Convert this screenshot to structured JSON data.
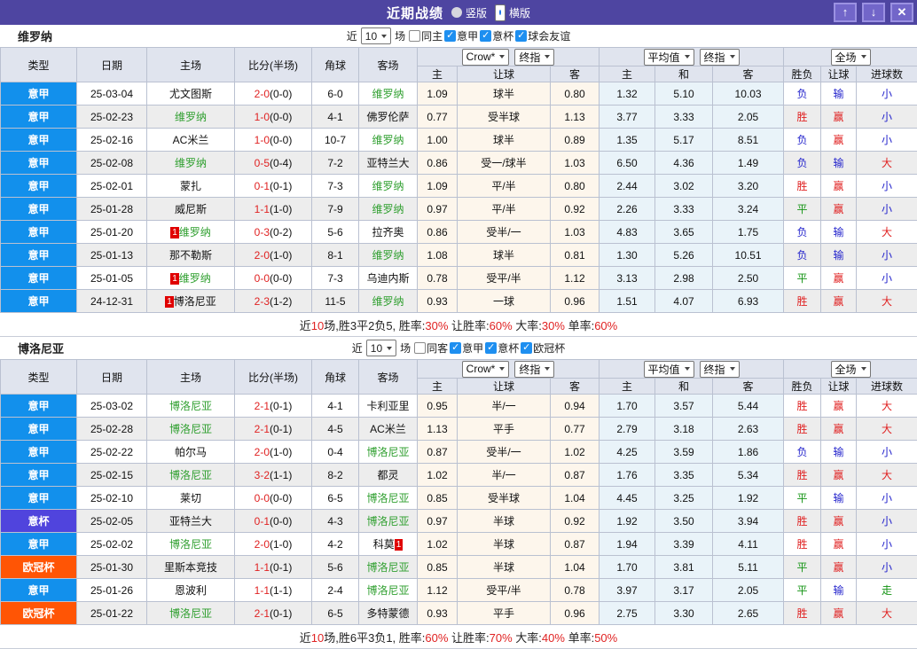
{
  "titlebar": {
    "title": "近期战绩",
    "radios": [
      {
        "label": "竖版",
        "selected": false
      },
      {
        "label": "横版",
        "selected": true
      }
    ],
    "buttons": {
      "up": "↑",
      "down": "↓",
      "close": "✕"
    }
  },
  "columns": [
    "类型",
    "日期",
    "主场",
    "比分(半场)",
    "角球",
    "客场",
    "主",
    "让球",
    "客",
    "主",
    "和",
    "客",
    "胜负",
    "让球",
    "进球数"
  ],
  "header_dropdowns": {
    "odds_source": "Crow*",
    "odds_final": "终指",
    "avg": "平均值",
    "avg_final": "终指",
    "scope": "全场"
  },
  "league_colors": {
    "意甲": "lg-serie",
    "意杯": "lg-coppa",
    "欧冠杯": "lg-ucl"
  },
  "sections": [
    {
      "team": "维罗纳",
      "filter": {
        "prefix": "近",
        "count": "10",
        "suffix": "场",
        "checks": [
          {
            "label": "同主",
            "checked": false
          },
          {
            "label": "意甲",
            "checked": true
          },
          {
            "label": "意杯",
            "checked": true
          },
          {
            "label": "球会友谊",
            "checked": true
          }
        ]
      },
      "rows": [
        {
          "league": "意甲",
          "date": "25-03-04",
          "home": {
            "name": "尤文图斯",
            "green": false,
            "badge": null
          },
          "score": "2-0",
          "half": "(0-0)",
          "corner": "6-0",
          "away": {
            "name": "维罗纳",
            "green": true,
            "badge": null
          },
          "odds": [
            "1.09",
            "球半",
            "0.80"
          ],
          "avg": [
            "1.32",
            "5.10",
            "10.03"
          ],
          "results": [
            {
              "t": "负",
              "c": "blue"
            },
            {
              "t": "输",
              "c": "blue"
            },
            {
              "t": "小",
              "c": "blue"
            }
          ]
        },
        {
          "league": "意甲",
          "date": "25-02-23",
          "home": {
            "name": "维罗纳",
            "green": true,
            "badge": null
          },
          "score": "1-0",
          "half": "(0-0)",
          "corner": "4-1",
          "away": {
            "name": "佛罗伦萨",
            "green": false,
            "badge": null
          },
          "odds": [
            "0.77",
            "受半球",
            "1.13"
          ],
          "avg": [
            "3.77",
            "3.33",
            "2.05"
          ],
          "results": [
            {
              "t": "胜",
              "c": "red"
            },
            {
              "t": "赢",
              "c": "red"
            },
            {
              "t": "小",
              "c": "blue"
            }
          ]
        },
        {
          "league": "意甲",
          "date": "25-02-16",
          "home": {
            "name": "AC米兰",
            "green": false,
            "badge": null
          },
          "score": "1-0",
          "half": "(0-0)",
          "corner": "10-7",
          "away": {
            "name": "维罗纳",
            "green": true,
            "badge": null
          },
          "odds": [
            "1.00",
            "球半",
            "0.89"
          ],
          "avg": [
            "1.35",
            "5.17",
            "8.51"
          ],
          "results": [
            {
              "t": "负",
              "c": "blue"
            },
            {
              "t": "赢",
              "c": "red"
            },
            {
              "t": "小",
              "c": "blue"
            }
          ]
        },
        {
          "league": "意甲",
          "date": "25-02-08",
          "home": {
            "name": "维罗纳",
            "green": true,
            "badge": null
          },
          "score": "0-5",
          "half": "(0-4)",
          "corner": "7-2",
          "away": {
            "name": "亚特兰大",
            "green": false,
            "badge": null
          },
          "odds": [
            "0.86",
            "受一/球半",
            "1.03"
          ],
          "avg": [
            "6.50",
            "4.36",
            "1.49"
          ],
          "results": [
            {
              "t": "负",
              "c": "blue"
            },
            {
              "t": "输",
              "c": "blue"
            },
            {
              "t": "大",
              "c": "red"
            }
          ]
        },
        {
          "league": "意甲",
          "date": "25-02-01",
          "home": {
            "name": "蒙扎",
            "green": false,
            "badge": null
          },
          "score": "0-1",
          "half": "(0-1)",
          "corner": "7-3",
          "away": {
            "name": "维罗纳",
            "green": true,
            "badge": null
          },
          "odds": [
            "1.09",
            "平/半",
            "0.80"
          ],
          "avg": [
            "2.44",
            "3.02",
            "3.20"
          ],
          "results": [
            {
              "t": "胜",
              "c": "red"
            },
            {
              "t": "赢",
              "c": "red"
            },
            {
              "t": "小",
              "c": "blue"
            }
          ]
        },
        {
          "league": "意甲",
          "date": "25-01-28",
          "home": {
            "name": "威尼斯",
            "green": false,
            "badge": null
          },
          "score": "1-1",
          "half": "(1-0)",
          "corner": "7-9",
          "away": {
            "name": "维罗纳",
            "green": true,
            "badge": null
          },
          "odds": [
            "0.97",
            "平/半",
            "0.92"
          ],
          "avg": [
            "2.26",
            "3.33",
            "3.24"
          ],
          "results": [
            {
              "t": "平",
              "c": "green"
            },
            {
              "t": "赢",
              "c": "red"
            },
            {
              "t": "小",
              "c": "blue"
            }
          ]
        },
        {
          "league": "意甲",
          "date": "25-01-20",
          "home": {
            "name": "维罗纳",
            "green": true,
            "badge": {
              "text": "1",
              "pos": "before"
            }
          },
          "score": "0-3",
          "half": "(0-2)",
          "corner": "5-6",
          "away": {
            "name": "拉齐奥",
            "green": false,
            "badge": null
          },
          "odds": [
            "0.86",
            "受半/一",
            "1.03"
          ],
          "avg": [
            "4.83",
            "3.65",
            "1.75"
          ],
          "results": [
            {
              "t": "负",
              "c": "blue"
            },
            {
              "t": "输",
              "c": "blue"
            },
            {
              "t": "大",
              "c": "red"
            }
          ]
        },
        {
          "league": "意甲",
          "date": "25-01-13",
          "home": {
            "name": "那不勒斯",
            "green": false,
            "badge": null
          },
          "score": "2-0",
          "half": "(1-0)",
          "corner": "8-1",
          "away": {
            "name": "维罗纳",
            "green": true,
            "badge": null
          },
          "odds": [
            "1.08",
            "球半",
            "0.81"
          ],
          "avg": [
            "1.30",
            "5.26",
            "10.51"
          ],
          "results": [
            {
              "t": "负",
              "c": "blue"
            },
            {
              "t": "输",
              "c": "blue"
            },
            {
              "t": "小",
              "c": "blue"
            }
          ]
        },
        {
          "league": "意甲",
          "date": "25-01-05",
          "home": {
            "name": "维罗纳",
            "green": true,
            "badge": {
              "text": "1",
              "pos": "before"
            }
          },
          "score": "0-0",
          "half": "(0-0)",
          "corner": "7-3",
          "away": {
            "name": "乌迪内斯",
            "green": false,
            "badge": null
          },
          "odds": [
            "0.78",
            "受平/半",
            "1.12"
          ],
          "avg": [
            "3.13",
            "2.98",
            "2.50"
          ],
          "results": [
            {
              "t": "平",
              "c": "green"
            },
            {
              "t": "赢",
              "c": "red"
            },
            {
              "t": "小",
              "c": "blue"
            }
          ]
        },
        {
          "league": "意甲",
          "date": "24-12-31",
          "home": {
            "name": "博洛尼亚",
            "green": false,
            "badge": {
              "text": "1",
              "pos": "before"
            }
          },
          "score": "2-3",
          "half": "(1-2)",
          "corner": "11-5",
          "away": {
            "name": "维罗纳",
            "green": true,
            "badge": null
          },
          "odds": [
            "0.93",
            "一球",
            "0.96"
          ],
          "avg": [
            "1.51",
            "4.07",
            "6.93"
          ],
          "results": [
            {
              "t": "胜",
              "c": "red"
            },
            {
              "t": "赢",
              "c": "red"
            },
            {
              "t": "大",
              "c": "red"
            }
          ]
        }
      ],
      "summary": [
        {
          "t": "近"
        },
        {
          "t": "10",
          "red": true
        },
        {
          "t": "场,胜3平2负5, 胜率:"
        },
        {
          "t": "30%",
          "red": true
        },
        {
          "t": " 让胜率:"
        },
        {
          "t": "60%",
          "red": true
        },
        {
          "t": " 大率:"
        },
        {
          "t": "30%",
          "red": true
        },
        {
          "t": " 单率:"
        },
        {
          "t": "60%",
          "red": true
        }
      ]
    },
    {
      "team": "博洛尼亚",
      "filter": {
        "prefix": "近",
        "count": "10",
        "suffix": "场",
        "checks": [
          {
            "label": "同客",
            "checked": false
          },
          {
            "label": "意甲",
            "checked": true
          },
          {
            "label": "意杯",
            "checked": true
          },
          {
            "label": "欧冠杯",
            "checked": true
          }
        ]
      },
      "rows": [
        {
          "league": "意甲",
          "date": "25-03-02",
          "home": {
            "name": "博洛尼亚",
            "green": true,
            "badge": null
          },
          "score": "2-1",
          "half": "(0-1)",
          "corner": "4-1",
          "away": {
            "name": "卡利亚里",
            "green": false,
            "badge": null
          },
          "odds": [
            "0.95",
            "半/一",
            "0.94"
          ],
          "avg": [
            "1.70",
            "3.57",
            "5.44"
          ],
          "results": [
            {
              "t": "胜",
              "c": "red"
            },
            {
              "t": "赢",
              "c": "red"
            },
            {
              "t": "大",
              "c": "red"
            }
          ]
        },
        {
          "league": "意甲",
          "date": "25-02-28",
          "home": {
            "name": "博洛尼亚",
            "green": true,
            "badge": null
          },
          "score": "2-1",
          "half": "(0-1)",
          "corner": "4-5",
          "away": {
            "name": "AC米兰",
            "green": false,
            "badge": null
          },
          "odds": [
            "1.13",
            "平手",
            "0.77"
          ],
          "avg": [
            "2.79",
            "3.18",
            "2.63"
          ],
          "results": [
            {
              "t": "胜",
              "c": "red"
            },
            {
              "t": "赢",
              "c": "red"
            },
            {
              "t": "大",
              "c": "red"
            }
          ]
        },
        {
          "league": "意甲",
          "date": "25-02-22",
          "home": {
            "name": "帕尔马",
            "green": false,
            "badge": null
          },
          "score": "2-0",
          "half": "(1-0)",
          "corner": "0-4",
          "away": {
            "name": "博洛尼亚",
            "green": true,
            "badge": null
          },
          "odds": [
            "0.87",
            "受半/一",
            "1.02"
          ],
          "avg": [
            "4.25",
            "3.59",
            "1.86"
          ],
          "results": [
            {
              "t": "负",
              "c": "blue"
            },
            {
              "t": "输",
              "c": "blue"
            },
            {
              "t": "小",
              "c": "blue"
            }
          ]
        },
        {
          "league": "意甲",
          "date": "25-02-15",
          "home": {
            "name": "博洛尼亚",
            "green": true,
            "badge": null
          },
          "score": "3-2",
          "half": "(1-1)",
          "corner": "8-2",
          "away": {
            "name": "都灵",
            "green": false,
            "badge": null
          },
          "odds": [
            "1.02",
            "半/一",
            "0.87"
          ],
          "avg": [
            "1.76",
            "3.35",
            "5.34"
          ],
          "results": [
            {
              "t": "胜",
              "c": "red"
            },
            {
              "t": "赢",
              "c": "red"
            },
            {
              "t": "大",
              "c": "red"
            }
          ]
        },
        {
          "league": "意甲",
          "date": "25-02-10",
          "home": {
            "name": "莱切",
            "green": false,
            "badge": null
          },
          "score": "0-0",
          "half": "(0-0)",
          "corner": "6-5",
          "away": {
            "name": "博洛尼亚",
            "green": true,
            "badge": null
          },
          "odds": [
            "0.85",
            "受半球",
            "1.04"
          ],
          "avg": [
            "4.45",
            "3.25",
            "1.92"
          ],
          "results": [
            {
              "t": "平",
              "c": "green"
            },
            {
              "t": "输",
              "c": "blue"
            },
            {
              "t": "小",
              "c": "blue"
            }
          ]
        },
        {
          "league": "意杯",
          "date": "25-02-05",
          "home": {
            "name": "亚特兰大",
            "green": false,
            "badge": null
          },
          "score": "0-1",
          "half": "(0-0)",
          "corner": "4-3",
          "away": {
            "name": "博洛尼亚",
            "green": true,
            "badge": null
          },
          "odds": [
            "0.97",
            "半球",
            "0.92"
          ],
          "avg": [
            "1.92",
            "3.50",
            "3.94"
          ],
          "results": [
            {
              "t": "胜",
              "c": "red"
            },
            {
              "t": "赢",
              "c": "red"
            },
            {
              "t": "小",
              "c": "blue"
            }
          ]
        },
        {
          "league": "意甲",
          "date": "25-02-02",
          "home": {
            "name": "博洛尼亚",
            "green": true,
            "badge": null
          },
          "score": "2-0",
          "half": "(1-0)",
          "corner": "4-2",
          "away": {
            "name": "科莫",
            "green": false,
            "badge": {
              "text": "1",
              "pos": "after"
            }
          },
          "odds": [
            "1.02",
            "半球",
            "0.87"
          ],
          "avg": [
            "1.94",
            "3.39",
            "4.11"
          ],
          "results": [
            {
              "t": "胜",
              "c": "red"
            },
            {
              "t": "赢",
              "c": "red"
            },
            {
              "t": "小",
              "c": "blue"
            }
          ]
        },
        {
          "league": "欧冠杯",
          "date": "25-01-30",
          "home": {
            "name": "里斯本竞技",
            "green": false,
            "badge": null
          },
          "score": "1-1",
          "half": "(0-1)",
          "corner": "5-6",
          "away": {
            "name": "博洛尼亚",
            "green": true,
            "badge": null
          },
          "odds": [
            "0.85",
            "半球",
            "1.04"
          ],
          "avg": [
            "1.70",
            "3.81",
            "5.11"
          ],
          "results": [
            {
              "t": "平",
              "c": "green"
            },
            {
              "t": "赢",
              "c": "red"
            },
            {
              "t": "小",
              "c": "blue"
            }
          ]
        },
        {
          "league": "意甲",
          "date": "25-01-26",
          "home": {
            "name": "恩波利",
            "green": false,
            "badge": null
          },
          "score": "1-1",
          "half": "(1-1)",
          "corner": "2-4",
          "away": {
            "name": "博洛尼亚",
            "green": true,
            "badge": null
          },
          "odds": [
            "1.12",
            "受平/半",
            "0.78"
          ],
          "avg": [
            "3.97",
            "3.17",
            "2.05"
          ],
          "results": [
            {
              "t": "平",
              "c": "green"
            },
            {
              "t": "输",
              "c": "blue"
            },
            {
              "t": "走",
              "c": "green"
            }
          ]
        },
        {
          "league": "欧冠杯",
          "date": "25-01-22",
          "home": {
            "name": "博洛尼亚",
            "green": true,
            "badge": null
          },
          "score": "2-1",
          "half": "(0-1)",
          "corner": "6-5",
          "away": {
            "name": "多特蒙德",
            "green": false,
            "badge": null
          },
          "odds": [
            "0.93",
            "平手",
            "0.96"
          ],
          "avg": [
            "2.75",
            "3.30",
            "2.65"
          ],
          "results": [
            {
              "t": "胜",
              "c": "red"
            },
            {
              "t": "赢",
              "c": "red"
            },
            {
              "t": "大",
              "c": "red"
            }
          ]
        }
      ],
      "summary": [
        {
          "t": "近"
        },
        {
          "t": "10",
          "red": true
        },
        {
          "t": "场,胜6平3负1, 胜率:"
        },
        {
          "t": "60%",
          "red": true
        },
        {
          "t": " 让胜率:"
        },
        {
          "t": "70%",
          "red": true
        },
        {
          "t": " 大率:"
        },
        {
          "t": "40%",
          "red": true
        },
        {
          "t": " 单率:"
        },
        {
          "t": "50%",
          "red": true
        }
      ]
    }
  ]
}
